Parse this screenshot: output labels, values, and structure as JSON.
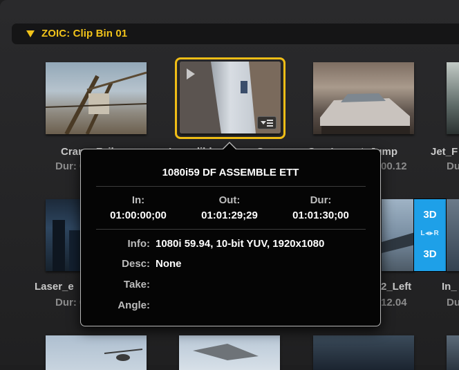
{
  "bin": {
    "title": "ZOIC: Clip Bin 01"
  },
  "clips": [
    {
      "name": "Crane_Fail",
      "dur_prefix": "Dur: 0"
    },
    {
      "name": "Incredible_Jump_Sc",
      "dur_prefix": ""
    },
    {
      "name": "Car_Impact_Jump",
      "dur_suffix": "00.12"
    },
    {
      "name": "Jet_F",
      "dur_prefix": "Du"
    },
    {
      "name": "Laser_e",
      "dur_prefix": "Dur: 0"
    },
    {
      "name": "2_Left",
      "dur_suffix": "12.04"
    },
    {
      "name": "In_",
      "dur_prefix": "Du"
    }
  ],
  "badge3d": {
    "top": "3D",
    "middle": "L◂▸R",
    "bottom": "3D"
  },
  "tooltip": {
    "title": "1080i59 DF ASSEMBLE ETT",
    "in_label": "In:",
    "in_value": "01:00:00;00",
    "out_label": "Out:",
    "out_value": "01:01:29;29",
    "dur_label": "Dur:",
    "dur_value": "01:01:30;00",
    "info_label": "Info:",
    "info_value": "1080i 59.94, 10-bit YUV, 1920x1080",
    "desc_label": "Desc:",
    "desc_value": "None",
    "take_label": "Take:",
    "take_value": "",
    "angle_label": "Angle:",
    "angle_value": ""
  },
  "colors": {
    "accent": "#f1c31a",
    "badge": "#1ea0e8",
    "background": "#1e1e1f"
  },
  "icons": [
    "disclosure-triangle-icon",
    "play-icon",
    "clip-menu-icon"
  ]
}
